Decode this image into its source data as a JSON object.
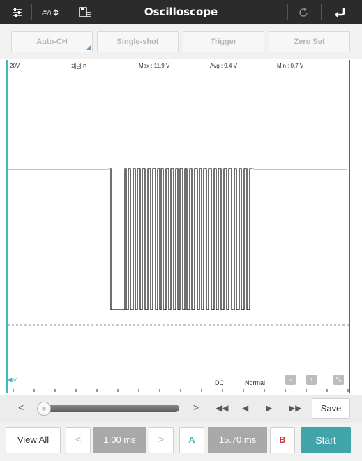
{
  "app": {
    "title": "Oscilloscope"
  },
  "toolbar": {
    "icons": [
      "settings-sliders-icon",
      "waveform-icon",
      "save-file-icon",
      "refresh-icon",
      "back-icon"
    ]
  },
  "buttons": {
    "auto_ch": "Auto-CH",
    "single_shot": "Single-shot",
    "trigger": "Trigger",
    "zero_set": "Zero Set"
  },
  "graph": {
    "voltage_scale": "20V",
    "channel": "채널 B",
    "max": "Max : 11.9 V",
    "avg": "Avg : 9.4 V",
    "min": "Min : 0.7 V",
    "zero_label": "0V",
    "coupling": "DC",
    "mode": "Normal",
    "trace_color": "#111111",
    "cursor_a_color": "#3fb9c0",
    "cursor_b_color": "#c43a3a"
  },
  "scroll": {
    "prev": "<",
    "next": ">",
    "save_label": "Save"
  },
  "bottom": {
    "view_all": "View All",
    "prev": "<",
    "time_div": "1.00 ms",
    "next": ">",
    "cursor_a": "A",
    "delta": "15.70 ms",
    "cursor_b": "B",
    "start": "Start",
    "accent": "#3fa5a8"
  }
}
